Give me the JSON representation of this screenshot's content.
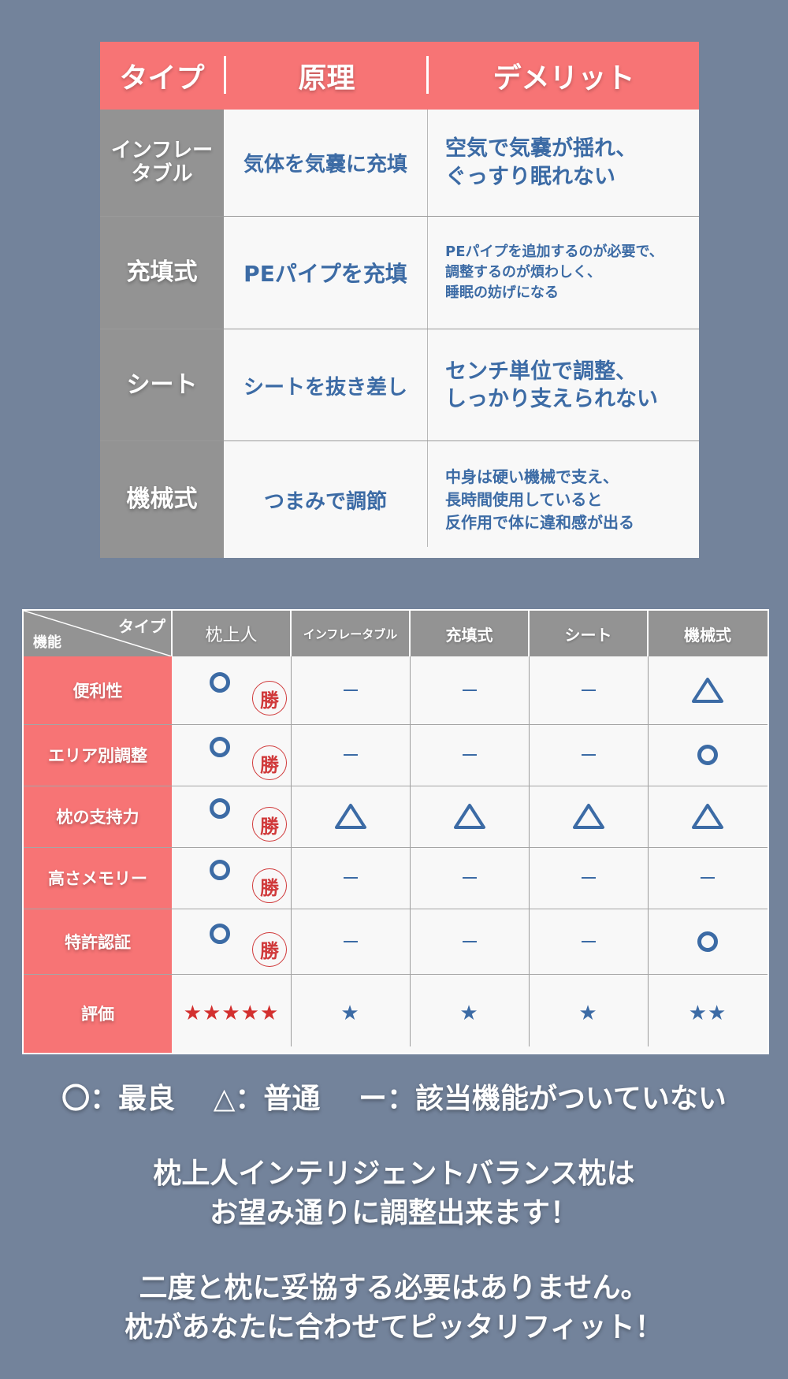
{
  "colors": {
    "background": "#73839b",
    "header_red": "#f77475",
    "side_gray": "#939393",
    "cell_bg": "#f8f8f8",
    "text_blue": "#3c6ba5",
    "win_red": "#d0393a"
  },
  "type_table": {
    "headers": [
      "タイプ",
      "原理",
      "デメリット"
    ],
    "rows": [
      {
        "type": "インフレー\nタブル",
        "principle": "気体を気嚢に充填",
        "demerit": "空気で気嚢が揺れ、\nぐっすり眠れない"
      },
      {
        "type": "充填式",
        "principle": "PEパイプを充填",
        "demerit": "PEパイプを追加するのが必要で、\n調整するのが煩わしく、\n睡眠の妨げになる"
      },
      {
        "type": "シート",
        "principle": "シートを抜き差し",
        "demerit": "センチ単位で調整、\nしっかり支えられない"
      },
      {
        "type": "機械式",
        "principle": "つまみで調節",
        "demerit": "中身は硬い機械で支え、\n長時間使用していると\n反作用で体に違和感が出る"
      }
    ]
  },
  "comparison_table": {
    "corner_row_label": "機能",
    "corner_col_label": "タイプ",
    "columns": [
      "枕上人",
      "インフレータブル",
      "充填式",
      "シート",
      "機械式"
    ],
    "win_badge": "勝",
    "rows": [
      {
        "label": "便利性",
        "values": [
          "circle",
          "dash",
          "dash",
          "dash",
          "triangle"
        ],
        "winner": true
      },
      {
        "label": "エリア別調整",
        "values": [
          "circle",
          "dash",
          "dash",
          "dash",
          "circle"
        ],
        "winner": true
      },
      {
        "label": "枕の支持力",
        "values": [
          "circle",
          "triangle",
          "triangle",
          "triangle",
          "triangle"
        ],
        "winner": true
      },
      {
        "label": "高さメモリー",
        "values": [
          "circle",
          "dash",
          "dash",
          "dash",
          "dash"
        ],
        "winner": true
      },
      {
        "label": "特許認証",
        "values": [
          "circle",
          "dash",
          "dash",
          "dash",
          "circle"
        ],
        "winner": true
      }
    ],
    "rating_row": {
      "label": "評価",
      "stars": [
        5,
        1,
        1,
        1,
        2
      ],
      "star_glyph": "★"
    }
  },
  "legend": [
    {
      "symbol": "〇",
      "meaning": "最良",
      "text": "〇：最良"
    },
    {
      "symbol": "△",
      "meaning": "普通",
      "text": "△：普通"
    },
    {
      "symbol": "ー",
      "meaning": "該当機能がついていない",
      "text": "ー：該当機能がついていない"
    }
  ],
  "closing": {
    "line_block_1": "枕上人インテリジェントバランス枕は\nお望み通りに調整出来ます！",
    "line_block_2": "二度と枕に妥協する必要はありません。\n枕があなたに合わせてピッタリフィット！"
  }
}
